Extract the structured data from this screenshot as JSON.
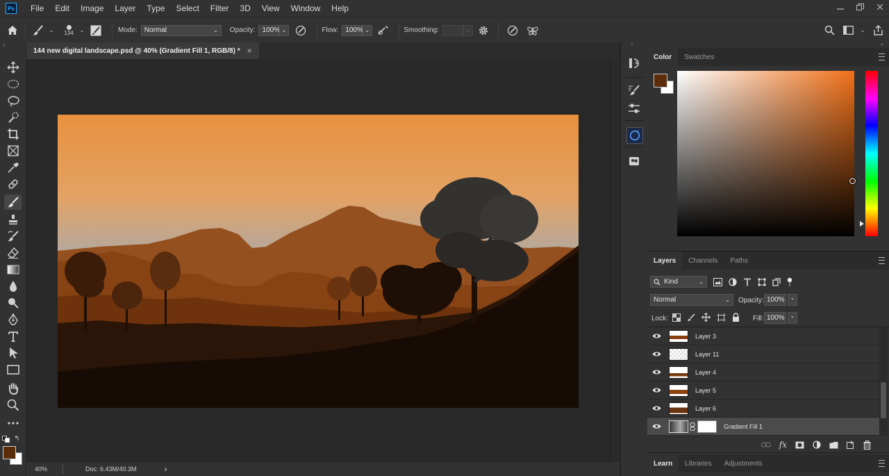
{
  "menu": {
    "logo": "Ps",
    "items": [
      "File",
      "Edit",
      "Image",
      "Layer",
      "Type",
      "Select",
      "Filter",
      "3D",
      "View",
      "Window",
      "Help"
    ]
  },
  "options": {
    "brush_size": "134",
    "mode_label": "Mode:",
    "mode_value": "Normal",
    "opacity_label": "Opacity:",
    "opacity_value": "100%",
    "flow_label": "Flow:",
    "flow_value": "100%",
    "smoothing_label": "Smoothing:",
    "smoothing_value": ""
  },
  "document": {
    "tab_title": "144 new digital landscape.psd @ 40% (Gradient Fill 1, RGB/8) *",
    "close_glyph": "×"
  },
  "status": {
    "zoom": "40%",
    "doc_size": "Doc: 6.43M/40.3M",
    "arrow": "›"
  },
  "color_panel": {
    "tabs": [
      "Color",
      "Swatches"
    ],
    "active_tab": "Color",
    "foreground_color": "#5a2c0a",
    "background_color": "#ffffff",
    "hue_color": "#f07018"
  },
  "layers_panel": {
    "tabs": [
      "Layers",
      "Channels",
      "Paths"
    ],
    "filter_label": "Kind",
    "blend_mode": "Normal",
    "opacity_label": "Opacity:",
    "opacity_value": "100%",
    "lock_label": "Lock:",
    "fill_label": "Fill:",
    "fill_value": "100%",
    "layers": [
      {
        "name": "Layer 3",
        "visible": true,
        "selected": false
      },
      {
        "name": "Layer 11",
        "visible": true,
        "selected": false
      },
      {
        "name": "Layer 4",
        "visible": true,
        "selected": false
      },
      {
        "name": "Layer 5",
        "visible": true,
        "selected": false
      },
      {
        "name": "Layer 6",
        "visible": true,
        "selected": false
      },
      {
        "name": "Gradient Fill 1",
        "visible": true,
        "selected": true
      }
    ],
    "footer_fx": "fx"
  },
  "bottom_tabs": [
    "Learn",
    "Libraries",
    "Adjustments"
  ],
  "colors": {
    "accent": "#31a8ff",
    "ui_bg": "#323232",
    "sky_top": "#e8913e",
    "sky_bottom": "#9aa9a8",
    "ground": "#170c05"
  }
}
